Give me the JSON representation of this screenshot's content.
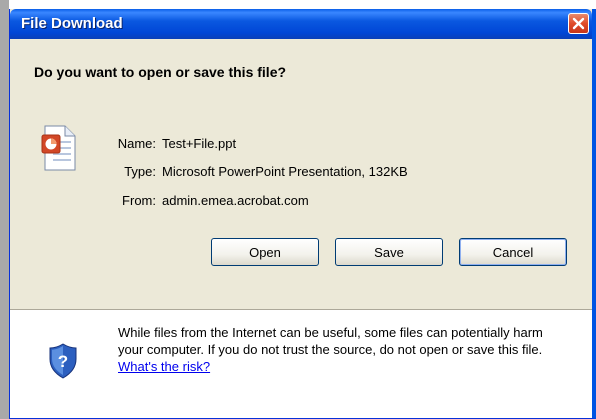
{
  "window": {
    "title": "File Download"
  },
  "dialog": {
    "question": "Do you want to open or save this file?",
    "file": {
      "name_label": "Name:",
      "name_value": "Test+File.ppt",
      "type_label": "Type:",
      "type_value": "Microsoft PowerPoint Presentation, 132KB",
      "from_label": "From:",
      "from_value": "admin.emea.acrobat.com",
      "icon": "powerpoint-file-icon"
    },
    "buttons": {
      "open": "Open",
      "save": "Save",
      "cancel": "Cancel"
    },
    "warning": {
      "text": "While files from the Internet can be useful, some files can potentially harm your computer. If you do not trust the source, do not open or save this file.",
      "link": "What's the risk?",
      "icon": "security-shield-icon"
    }
  },
  "colors": {
    "titlebar": "#0054e3",
    "dialog_bg": "#ece9d8",
    "close_button": "#e04b2a",
    "link": "#0000ee"
  }
}
